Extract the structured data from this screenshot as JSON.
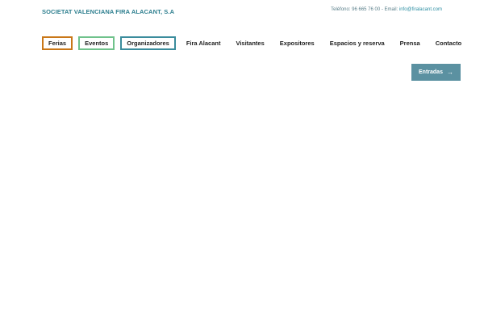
{
  "header": {
    "brand": "SOCIETAT VALENCIANA FIRA ALACANT, S.A",
    "contact_phone": "Teléfono: 96 665 76 00 - Email:",
    "contact_email": "info@firalacant.com"
  },
  "nav": {
    "items": [
      {
        "label": "Ferias"
      },
      {
        "label": "Eventos"
      },
      {
        "label": "Organizadores"
      },
      {
        "label": "Fira Alacant"
      },
      {
        "label": "Visitantes"
      },
      {
        "label": "Expositores"
      },
      {
        "label": "Espacios y reserva"
      },
      {
        "label": "Prensa"
      },
      {
        "label": "Contacto"
      }
    ]
  },
  "cta": {
    "label": "Entradas",
    "icon": "arrow-right-icon"
  },
  "colors": {
    "brand": "#2e7f8f",
    "ferias_border": "#c97718",
    "eventos_border": "#6fc28b",
    "organizadores_border": "#3a8c9c",
    "cta_background": "#5b91a1"
  }
}
